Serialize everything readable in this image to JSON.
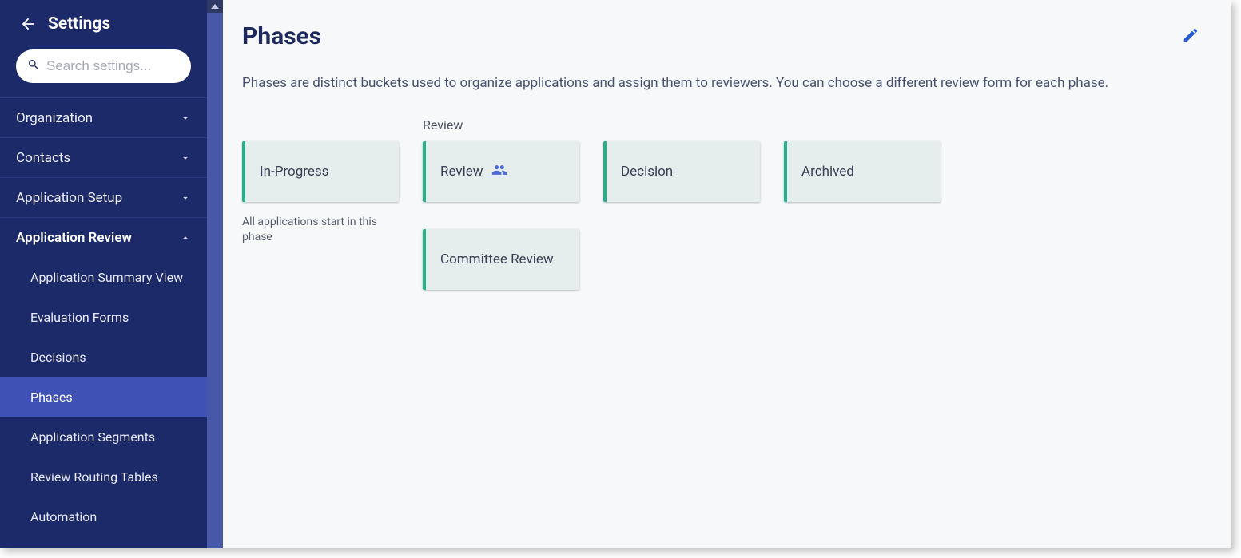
{
  "sidebar": {
    "title": "Settings",
    "search_placeholder": "Search settings...",
    "sections": [
      {
        "label": "Organization",
        "expanded": false
      },
      {
        "label": "Contacts",
        "expanded": false
      },
      {
        "label": "Application Setup",
        "expanded": false
      },
      {
        "label": "Application Review",
        "expanded": true
      }
    ],
    "sub_items": [
      {
        "label": "Application Summary View",
        "active": false
      },
      {
        "label": "Evaluation Forms",
        "active": false
      },
      {
        "label": "Decisions",
        "active": false
      },
      {
        "label": "Phases",
        "active": true
      },
      {
        "label": "Application Segments",
        "active": false
      },
      {
        "label": "Review Routing Tables",
        "active": false
      },
      {
        "label": "Automation",
        "active": false
      }
    ]
  },
  "main": {
    "title": "Phases",
    "description": "Phases are distinct buckets used to organize applications and assign them to reviewers. You can choose a different review form for each phase.",
    "columns": {
      "in_progress": {
        "header": "",
        "card": "In-Progress",
        "caption": "All applications start in this phase"
      },
      "review": {
        "header": "Review",
        "card1": "Review",
        "card2": "Committee Review"
      },
      "decision": {
        "header": "",
        "card": "Decision"
      },
      "archived": {
        "header": "",
        "card": "Archived"
      }
    }
  }
}
